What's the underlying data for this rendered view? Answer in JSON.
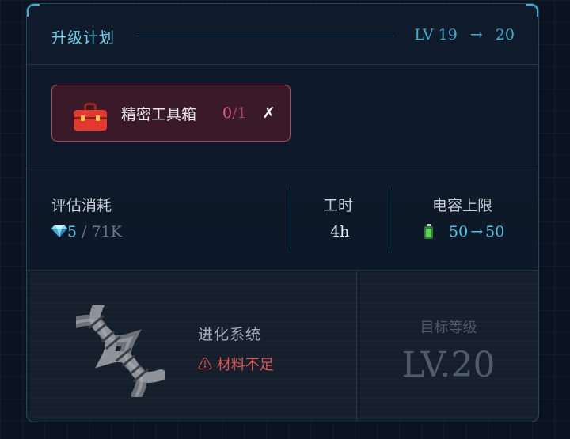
{
  "header": {
    "title": "升级计划",
    "level_prefix": "LV",
    "level_from": "19",
    "arrow": "→",
    "level_to": "20"
  },
  "materials": [
    {
      "icon": "toolbox-icon",
      "name": "精密工具箱",
      "owned": "0",
      "required": "/1",
      "status_mark": "✗",
      "status": "insufficient"
    }
  ],
  "stats": {
    "cost": {
      "label": "评估消耗",
      "icon": "gem-icon",
      "have": "5",
      "need": "/ 71K"
    },
    "hours": {
      "label": "工时",
      "value": "4h"
    },
    "capacity": {
      "label": "电容上限",
      "icon": "battery-icon",
      "from": "50",
      "arrow": "→",
      "to": "50"
    }
  },
  "system": {
    "icon": "dna-icon",
    "name": "进化系统",
    "warning_icon": "⚠",
    "warning": "材料不足"
  },
  "target": {
    "label": "目标等级",
    "level": "LV.20"
  },
  "colors": {
    "accent": "#3eaed4",
    "warning": "#e25252",
    "material_border": "#b0455b",
    "gem": "#4cc6ea"
  }
}
